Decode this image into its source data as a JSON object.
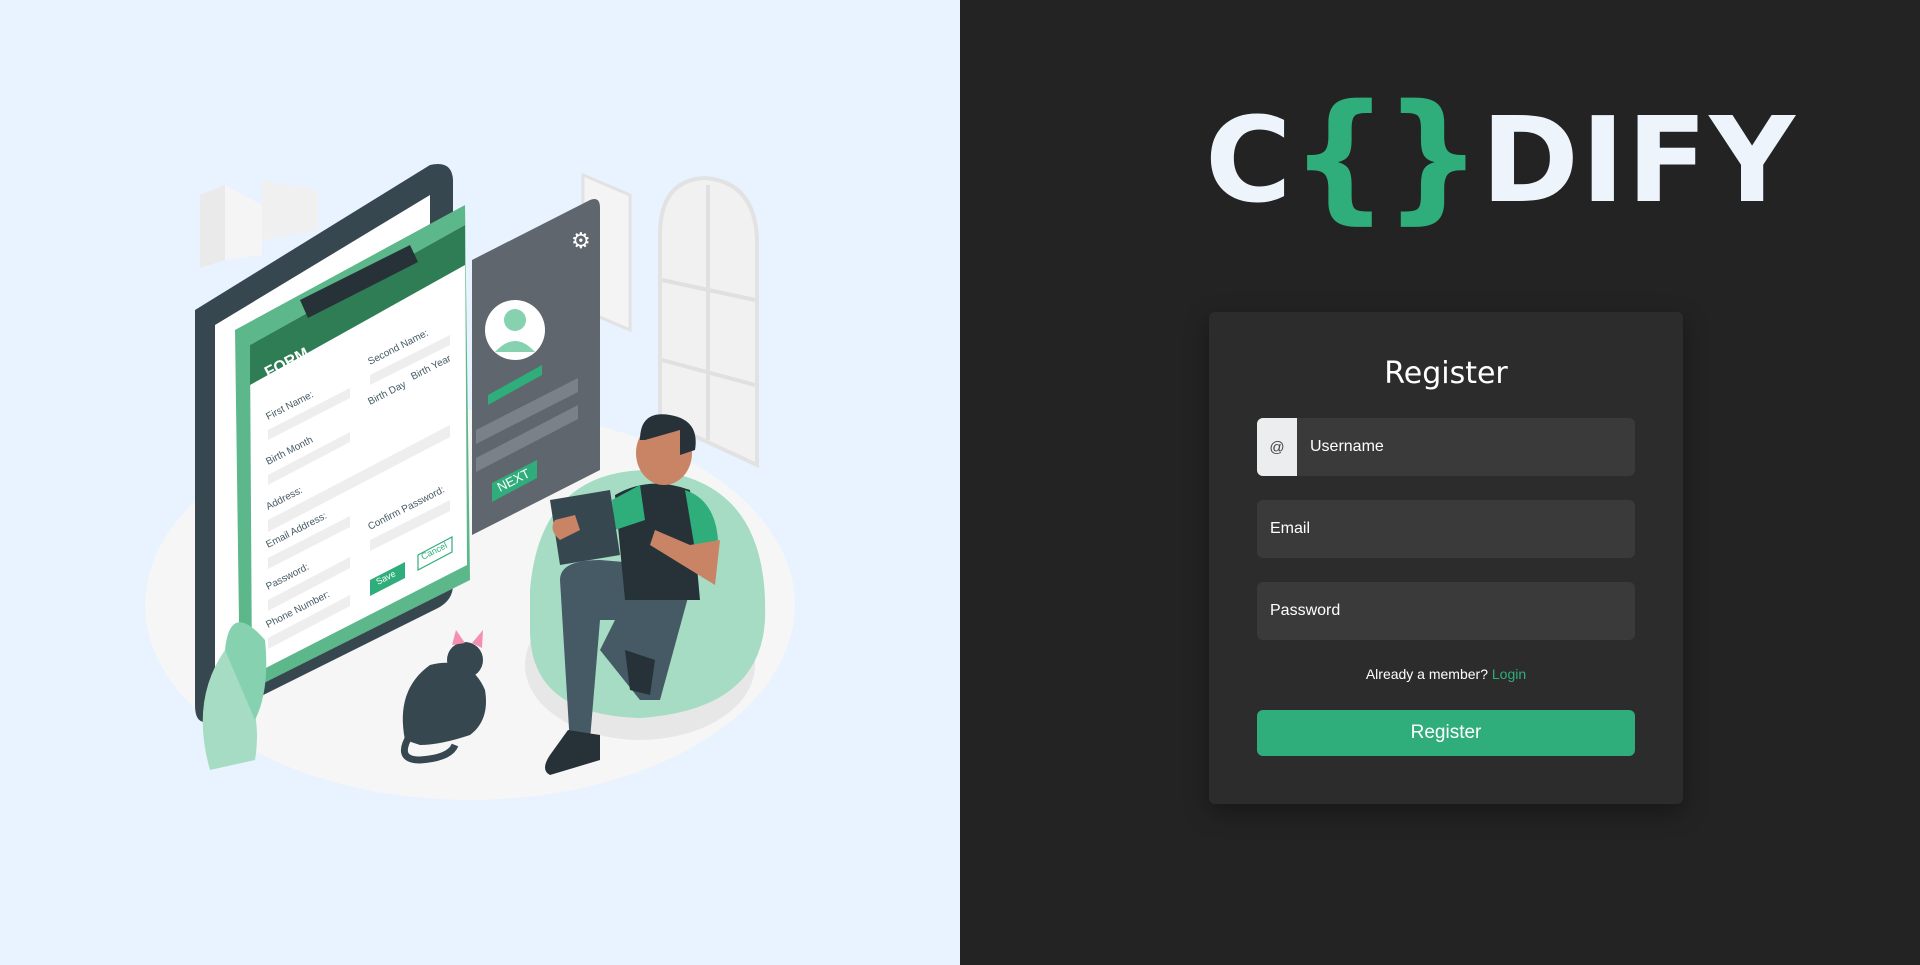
{
  "brand": {
    "logo_left": "C",
    "logo_brace_open": "{",
    "logo_brace_close": "}",
    "logo_right": "DIFY",
    "accent_color": "#2fad7a"
  },
  "illustration": {
    "form_title": "FORM",
    "labels": [
      "First Name:",
      "Second Name:",
      "Birth Month",
      "Birth Day",
      "Birth Year",
      "Address:",
      "Email Address:",
      "Confirm Password:",
      "Password:",
      "Phone Number:"
    ],
    "save_label": "Save",
    "cancel_label": "Cancel",
    "next_label": "NEXT"
  },
  "register": {
    "title": "Register",
    "username_prefix": "@",
    "username_placeholder": "Username",
    "email_placeholder": "Email",
    "password_placeholder": "Password",
    "member_text": "Already a member?",
    "login_link": "Login",
    "submit_label": "Register"
  }
}
